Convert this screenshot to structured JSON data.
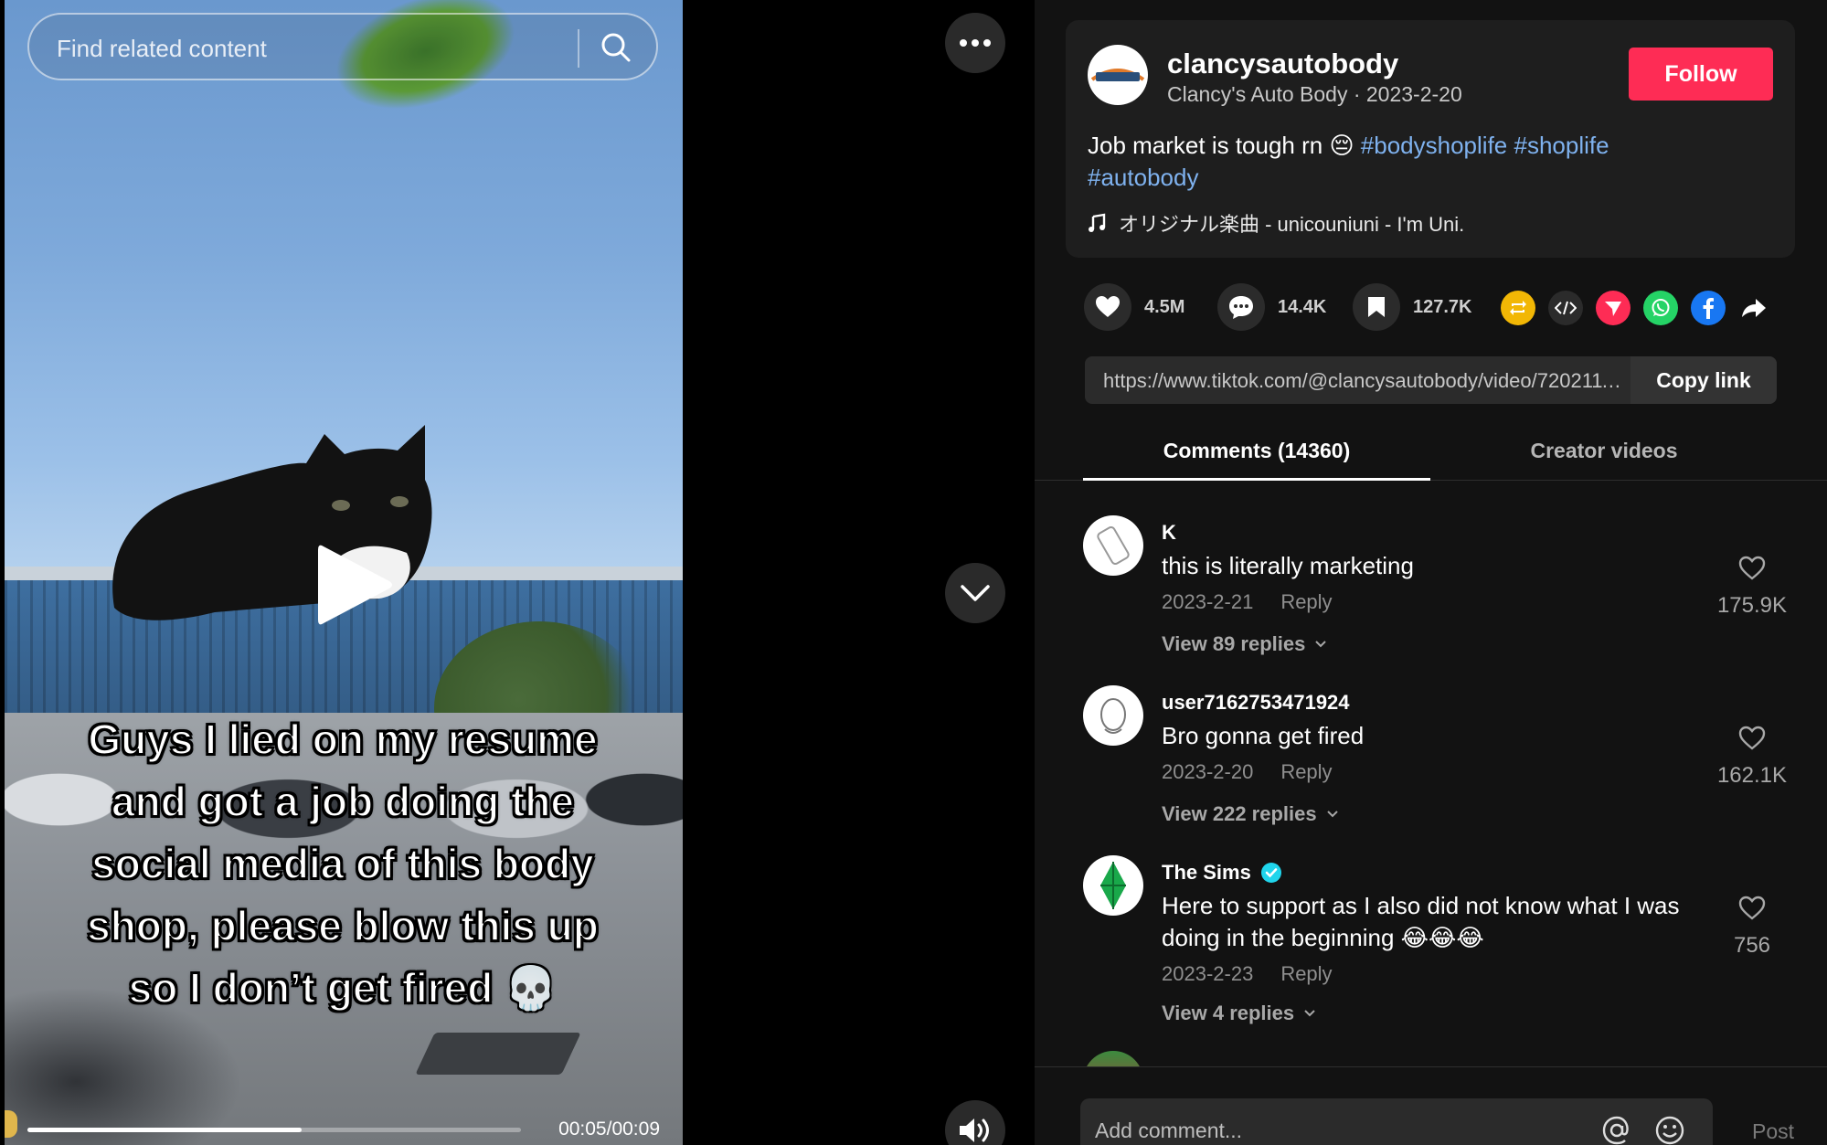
{
  "video": {
    "search_placeholder": "Find related content",
    "caption_lines": [
      "Guys I lied on my resume",
      "and got a job doing the",
      "social media of this body",
      "shop, please blow this up",
      "so I don’t get fired 💀"
    ],
    "time": "00:05/00:09",
    "progress_fraction": 0.556
  },
  "post": {
    "username": "clancysautobody",
    "subline": "Clancy's Auto Body · 2023-2-20",
    "follow_label": "Follow",
    "description_text": "Job market is tough rn 😔 ",
    "hashtags": [
      "#bodyshoplife",
      "#shoplife",
      "#autobody"
    ],
    "music": "オリジナル楽曲 - unicouniuni - I'm Uni."
  },
  "actions": {
    "likes": "4.5M",
    "comments": "14.4K",
    "saves": "127.7K"
  },
  "link": {
    "url": "https://www.tiktok.com/@clancysautobody/video/7202111111111111111",
    "copy_label": "Copy link"
  },
  "tabs": {
    "comments": "Comments (14360)",
    "creator": "Creator videos"
  },
  "comments": [
    {
      "user": "K",
      "text": "this is literally marketing",
      "date": "2023-2-21",
      "reply": "Reply",
      "likes": "175.9K",
      "replies": "View 89 replies"
    },
    {
      "user": "user7162753471924",
      "text": "Bro gonna get fired",
      "date": "2023-2-20",
      "reply": "Reply",
      "likes": "162.1K",
      "replies": "View 222 replies"
    },
    {
      "user": "The Sims",
      "text": "Here to support as I also did not know what I was doing in the beginning 😂😂😂",
      "date": "2023-2-23",
      "reply": "Reply",
      "likes": "756",
      "replies": "View 4 replies"
    }
  ],
  "composer": {
    "placeholder": "Add comment...",
    "post_label": "Post"
  },
  "colors": {
    "follow": "#fe2c55",
    "hashtag": "#7fb2ef",
    "verified": "#20d5ec"
  }
}
